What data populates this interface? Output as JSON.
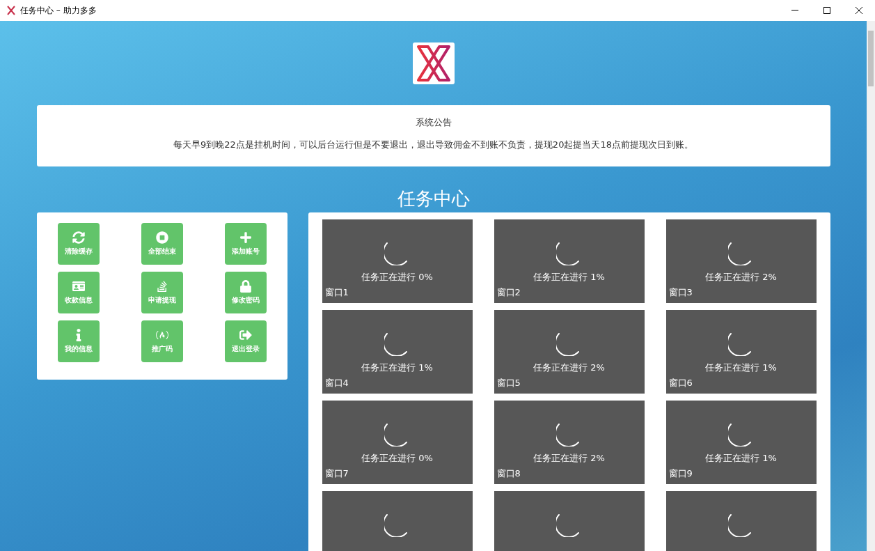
{
  "window": {
    "title": "任务中心 – 助力多多"
  },
  "notice": {
    "title": "系统公告",
    "text": "每天早9到晚22点是挂机时间，可以后台运行但是不要退出，退出导致佣金不到账不负责，提现20起提当天18点前提现次日到账。"
  },
  "heading": "任务中心",
  "actions": [
    {
      "label": "清除缓存"
    },
    {
      "label": "全部结束"
    },
    {
      "label": "添加账号"
    },
    {
      "label": "收款信息"
    },
    {
      "label": "申请提现"
    },
    {
      "label": "修改密码"
    },
    {
      "label": "我的信息"
    },
    {
      "label": "推广码"
    },
    {
      "label": "退出登录"
    }
  ],
  "task_windows": [
    {
      "kind": "full",
      "status": "任务正在进行 0%",
      "label": "窗口1"
    },
    {
      "kind": "full",
      "status": "任务正在进行 1%",
      "label": "窗口2"
    },
    {
      "kind": "full",
      "status": "任务正在进行 2%",
      "label": "窗口3"
    },
    {
      "kind": "full",
      "status": "任务正在进行 1%",
      "label": "窗口4"
    },
    {
      "kind": "full",
      "status": "任务正在进行 2%",
      "label": "窗口5"
    },
    {
      "kind": "full",
      "status": "任务正在进行 1%",
      "label": "窗口6"
    },
    {
      "kind": "full",
      "status": "任务正在进行 0%",
      "label": "窗口7"
    },
    {
      "kind": "full",
      "status": "任务正在进行 2%",
      "label": "窗口8"
    },
    {
      "kind": "full",
      "status": "任务正在进行 1%",
      "label": "窗口9"
    },
    {
      "kind": "cut"
    },
    {
      "kind": "cut"
    },
    {
      "kind": "cut"
    }
  ]
}
